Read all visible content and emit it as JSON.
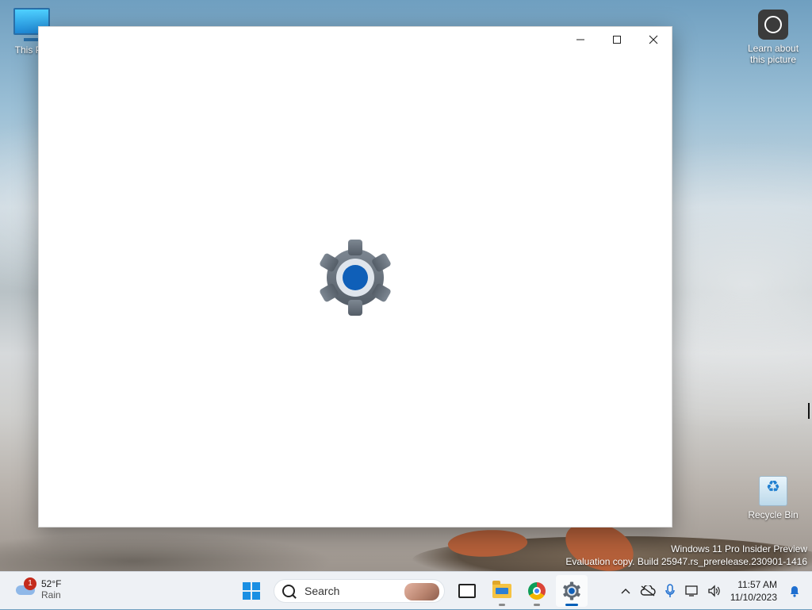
{
  "desktop": {
    "icons": [
      {
        "label": "This PC"
      },
      {
        "label": "Learn about this picture"
      },
      {
        "label": "Recycle Bin"
      }
    ],
    "watermark": {
      "line1": "Windows 11 Pro Insider Preview",
      "line2": "Evaluation copy. Build 25947.rs_prerelease.230901-1416"
    }
  },
  "window": {
    "app_icon": "settings-gear-icon",
    "controls": {
      "minimize": "minimize-icon",
      "maximize": "maximize-icon",
      "close": "close-icon"
    },
    "colors": {
      "gear": "#6b7580",
      "accent": "#0f5fb8"
    }
  },
  "taskbar": {
    "weather": {
      "badge": "1",
      "temp": "52°F",
      "condition": "Rain"
    },
    "search": {
      "placeholder": "Search"
    },
    "apps": [
      "start",
      "search",
      "task-view",
      "file-explorer",
      "chrome",
      "settings"
    ],
    "tray": {
      "time": "11:57 AM",
      "date": "11/10/2023"
    },
    "colors": {
      "accent": "#005fb8"
    }
  }
}
